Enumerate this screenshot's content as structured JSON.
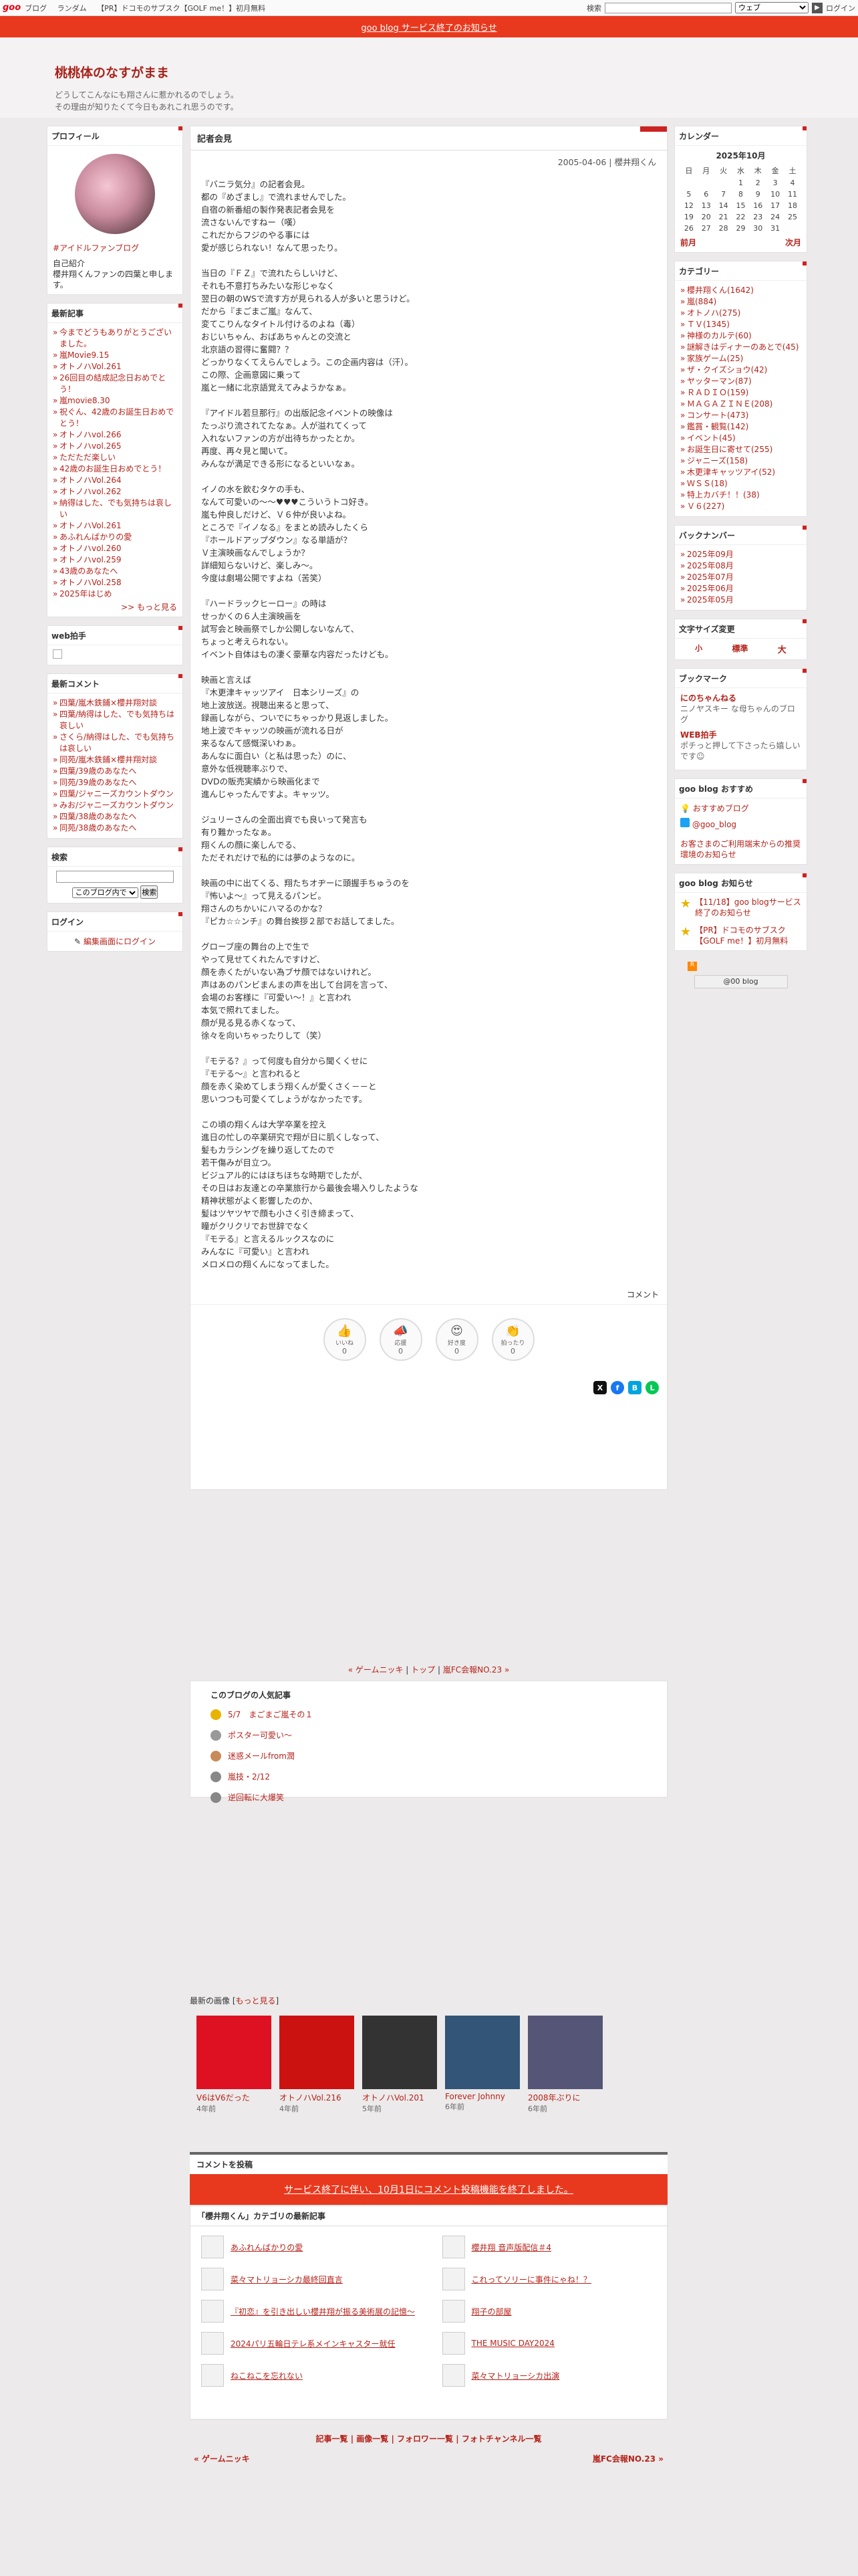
{
  "topbar": {
    "logo": "goo",
    "links": [
      "ブログ",
      "ランダム",
      "【PR】ドコモのサブスク【GOLF me！】初月無料"
    ],
    "engine": "ウェブ",
    "login": "ログイン"
  },
  "notice": "goo blog サービス終了のお知らせ",
  "site": {
    "title": "桃桃体のなすがまま",
    "desc1": "どうしてこんなにも翔さんに惹かれるのでしょう。",
    "desc2": "その理由が知りたくて今日もあれこれ思うのです。"
  },
  "profile": {
    "heading": "プロフィール",
    "tag": "#アイドルファンブログ",
    "intro_title": "自己紹介",
    "intro": "櫻井翔くんファンの四葉と申します。"
  },
  "recent": {
    "heading": "最新記事",
    "items": [
      "今までどうもありがとうございました。",
      "嵐Movie9.15",
      "オトノハVol.261",
      "26回目の結成記念日おめでとう！",
      "嵐movie8.30",
      "祝ぐん、42歳のお誕生日おめでとう！",
      "オトノハvol.266",
      "オトノハvol.265",
      "ただただ楽しい",
      "42歳のお誕生日おめでとう！",
      "オトノハVol.264",
      "オトノハvol.262",
      "納得はした、でも気持ちは哀しい",
      "オトノハVol.261",
      "あふれんばかりの愛",
      "オトノハvol.260",
      "オトノハvol.259",
      "43歳のあなたへ",
      "オトノハVol.258",
      "2025年はじめ"
    ],
    "more": ">> もっと見る"
  },
  "webclap": {
    "heading": "web拍手"
  },
  "comments": {
    "heading": "最新コメント",
    "items": [
      "四葉/嵐木鉄鋪×櫻井翔対談",
      "四葉/納得はした、でも気持ちは哀しい",
      "さくら/納得はした、でも気持ちは哀しい",
      "同苑/嵐木鉄鋪×櫻井翔対談",
      "四葉/39歳のあなたへ",
      "同苑/39歳のあなたへ",
      "四葉/ジャニーズカウントダウン",
      "みお/ジャニーズカウントダウン",
      "四葉/38歳のあなたへ",
      "同苑/38歳のあなたへ"
    ]
  },
  "search": {
    "heading": "検索",
    "scope": "このブログ内で",
    "button": "検索"
  },
  "login": {
    "heading": "ログイン",
    "link": "編集画面にログイン"
  },
  "article": {
    "box": "記者会見",
    "date": "2005-04-06 | 櫻井翔くん",
    "paras": [
      [
        "『バニラ気分』の記者会見。",
        "都の『めざまし』で流れませんでした。",
        "自宿の新番組の製作発表記者会見を",
        "流さないんですねー（嘆）",
        "これだからフジのやる事には",
        "愛が感じられない！なんて思ったり。"
      ],
      [
        "当日の『ＦＺ』で流れたらしいけど、",
        "それも不意打ちみたいな形じゃなく",
        "翌日の朝のWSで流す方が見られる人が多いと思うけど。",
        "だから『まごまご嵐』なんて、",
        "変てこりんなタイトル付けるのよね（毒）",
        "おじいちゃん、おばあちゃんとの交流と",
        "北京語の習得に奮闘？？",
        "どっかりなくてえらんでしょう。この企画内容は（汗）。",
        "この際、企画意図に乗って",
        "嵐と一緒に北京語覚えてみようかなぁ。"
      ],
      [
        "『アイドル若旦那行』の出版記念イベントの映像は",
        "たっぷり流されてたなぁ。人が溢れてくって",
        "入れないファンの方が出待ちかったとか。",
        "再度、再々見と聞いて。",
        "みんなが満足できる形になるといいなぁ。"
      ],
      [
        "イノの水を飲むタケの手も、",
        "なんて可愛いの〜〜♥♥♥こういうトコ好き。",
        "嵐も仲良しだけど、Ｖ６仲が良いよね。",
        "ところで『イノなる』をまとめ読みしたくら",
        "『ホールドアップダウン』なる単語が？",
        "Ｖ主演映画なんでしょうか？",
        "詳細知らないけど、楽しみ〜。",
        "今度は劇場公開ですよね（苦笑）"
      ],
      [
        "『ハードラックヒーロー』の時は",
        "せっかくの６人主演映画を",
        "試写会と映画祭でしか公開しないなんて、",
        "ちょっと考えられない。",
        "イベント自体はもの凄く豪華な内容だったけども。"
      ],
      [
        "映画と言えば",
        "『木更津キャッツアイ　日本シリーズ』の",
        "地上波放送。視聴出来ると思って、",
        "録画しながら、ついでにちゃっかり見返しました。",
        "地上波でキャッツの映画が流れる日が",
        "来るなんて感慨深いわぁ。",
        "あんなに面白い（と私は思った）のに、",
        "意外な低視聴率ぶりで、",
        "DVDの販売実績から映画化まで",
        "進んじゃったんですよ。キャッツ。"
      ],
      [
        "ジュリーさんの全面出資でも良いって発言も",
        "有り難かったなぁ。",
        "翔くんの顔に楽しんでる、",
        "ただそれだけで私的には夢のようなのに。"
      ],
      [
        "映画の中に出てくる、翔たちオヂーに頭握手ちゅうのを",
        "『怖いよ〜』って見えるパンビ。",
        "翔さんのちかいにハマるのかな？",
        "『ピカ☆☆ンチ』の舞台挨拶２部でお話してました。"
      ],
      [
        "グローブ座の舞台の上で生で",
        "やって見せてくれたんですけど、",
        "顔を赤くたがいない為ブサ顔ではないけれど。",
        "声はあのパンビまんまの声を出して台詞を言って、",
        "会場のお客様に『可愛い〜！』と言われ",
        "本気で照れてました。",
        "顔が見る見る赤くなって、",
        "徐々を向いちゃったりして（笑）"
      ],
      [
        "『モテる？』って何度も自分から聞くくせに",
        "『モテる〜』と言われると",
        "顔を赤く染めてしまう翔くんが愛くさく－－と",
        "思いつつも可愛くてしょうがなかったです。"
      ],
      [
        "この頃の翔くんは大学卒業を控え",
        "進日の忙しの卒業研究で翔が日に肌くしなって、",
        "髪もカラシングを繰り返してたので",
        "若干傷みが目立つ。",
        "ビジュアル的にはほちほちな時期でしたが、",
        "その日はお友達との卒業旅行から最後会場入りしたような",
        "精神状態がよく影響したのか、",
        "髪はツヤツヤで顔も小さく引き締まって、",
        "瞳がクリクリでお世辞でなく",
        "『モテる』と言えるルックスなのに",
        "みんなに『可愛い』と言われ",
        "メロメロの翔くんになってました。"
      ]
    ],
    "comment_label": "コメント",
    "reactions": [
      {
        "icon": "👍",
        "label": "いいね",
        "count": "0"
      },
      {
        "icon": "📣",
        "label": "応援",
        "count": "0"
      },
      {
        "icon": "😍",
        "label": "好き度",
        "count": "0"
      },
      {
        "icon": "👏",
        "label": "拍ったり",
        "count": "0"
      }
    ]
  },
  "pager": {
    "prev": "« ゲームニッキ",
    "top": "トップ",
    "next": "嵐FC会報NO.23 »"
  },
  "popular": {
    "heading": "このブログの人気記事",
    "items": [
      "5/7　まごまご嵐その１",
      "ポスター可愛い〜",
      "迷惑メールfrom潤",
      "嵐技・2/12",
      "逆回転に大爆笑"
    ]
  },
  "images": {
    "heading": "最新の画像",
    "more": "もっと見る",
    "items": [
      {
        "cap": "V6はV6だった",
        "ago": "4年前"
      },
      {
        "cap": "オトノハVol.216",
        "ago": "4年前"
      },
      {
        "cap": "オトノハVol.201",
        "ago": "5年前"
      },
      {
        "cap": "Forever Johnny",
        "ago": "6年前"
      },
      {
        "cap": "2008年ぶりに",
        "ago": "6年前"
      }
    ]
  },
  "comment_post": {
    "heading": "コメントを投稿",
    "banner": "サービス終了に伴い、10月1日にコメント投稿機能を終了しました。"
  },
  "catnew": {
    "heading": "「櫻井翔くん」カテゴリの最新記事",
    "items": [
      "あふれんばかりの愛",
      "櫻井翔 音声版配信＃4",
      "菜々マトリョーシカ最終回直言",
      "これってソリーに事件にゃね！？",
      "『初恋』を引き出しい櫻井翔が振る美術展の記憶〜",
      "翔子の部屋",
      "2024パリ五輪日テレ系メインキャスター就任",
      "THE MUSIC DAY2024",
      "ねこねこを忘れない",
      "菜々マトリョーシカ出演"
    ]
  },
  "footnav": [
    "記事一覧",
    "画像一覧",
    "フォロワー一覧",
    "フォトチャンネル一覧"
  ],
  "calendar": {
    "heading": "カレンダー",
    "month": "2025年10月",
    "days": [
      "日",
      "月",
      "火",
      "水",
      "木",
      "金",
      "土"
    ],
    "weeks": [
      [
        "",
        "",
        "",
        "1",
        "2",
        "3",
        "4"
      ],
      [
        "5",
        "6",
        "7",
        "8",
        "9",
        "10",
        "11"
      ],
      [
        "12",
        "13",
        "14",
        "15",
        "16",
        "17",
        "18"
      ],
      [
        "19",
        "20",
        "21",
        "22",
        "23",
        "24",
        "25"
      ],
      [
        "26",
        "27",
        "28",
        "29",
        "30",
        "31",
        ""
      ]
    ],
    "prev": "前月",
    "next": "次月"
  },
  "categories": {
    "heading": "カテゴリー",
    "items": [
      "櫻井翔くん(1642)",
      "嵐(884)",
      "オトノハ(275)",
      "ＴＶ(1345)",
      "神様のカルテ(60)",
      "謎解きはディナーのあとで(45)",
      "家族ゲーム(25)",
      "ザ・クイズショウ(42)",
      "ヤッターマン(87)",
      "ＲＡＤＩＯ(159)",
      "ＭＡＧＡＺＩＮＥ(208)",
      "コンサート(473)",
      "鑑賞・観覧(142)",
      "イベント(45)",
      "お誕生日に寄せて(255)",
      "ジャニーズ(158)",
      "木更津キャッツアイ(52)",
      "ＷＳＳ(18)",
      "特上カバチ！！(38)",
      "Ｖ６(227)"
    ]
  },
  "backnumber": {
    "heading": "バックナンバー",
    "items": [
      "2025年09月",
      "2025年08月",
      "2025年07月",
      "2025年06月",
      "2025年05月"
    ]
  },
  "fontsize": {
    "heading": "文字サイズ変更",
    "small": "小",
    "std": "標準",
    "large": "大"
  },
  "bookmark": {
    "heading": "ブックマーク",
    "items": [
      {
        "t": "にのちゃんねる",
        "d": "ニノヤスキー な母ちゃんのブログ"
      },
      {
        "t": "WEB拍手",
        "d": "ポチっと押して下さったら嬉しいです☺"
      }
    ]
  },
  "goo_osusume": {
    "heading": "goo blog おすすめ",
    "items": [
      "おすすめブログ",
      "@goo_blog"
    ],
    "note": "お客さまのご利用端末からの推奨環境のお知らせ"
  },
  "goo_oshirase": {
    "heading": "goo blog お知らせ",
    "items": [
      "【11/18】goo blogサービス終了のお知らせ",
      "【PR】ドコモのサブスク【GOLF me！】初月無料"
    ]
  },
  "badge": "@00 blog"
}
